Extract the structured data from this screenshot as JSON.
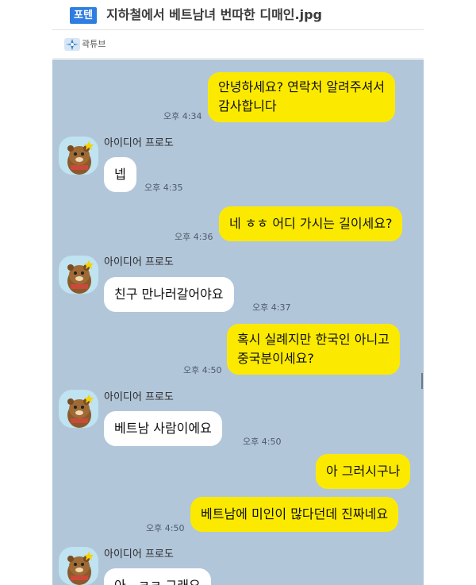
{
  "post": {
    "badge": "포텐",
    "title": "지하철에서 베트남녀 번따한 디매인.jpg",
    "author": "곽튜브"
  },
  "chat": {
    "messages": [
      {
        "sender": "me",
        "lines": [
          "안녕하세요? 연락처 알려주셔서",
          "감사합니다"
        ],
        "time": "오후 4:34"
      },
      {
        "sender": "them",
        "name": "아이디어 프로도",
        "lines": [
          "넵"
        ],
        "time": "오후 4:35"
      },
      {
        "sender": "me",
        "lines": [
          "네 ㅎㅎ 어디 가시는 길이세요?"
        ],
        "time": "오후 4:36"
      },
      {
        "sender": "them",
        "name": "아이디어 프로도",
        "lines": [
          "친구 만나러갈어야요"
        ],
        "time": "오후 4:37"
      },
      {
        "sender": "me",
        "lines": [
          "혹시 실례지만 한국인 아니고",
          "중국분이세요?"
        ],
        "time": "오후 4:50"
      },
      {
        "sender": "them",
        "name": "아이디어 프로도",
        "lines": [
          "베트남 사람이에요"
        ],
        "time": "오후 4:50"
      },
      {
        "sender": "me",
        "lines": [
          "아 그러시구나"
        ],
        "time": ""
      },
      {
        "sender": "me",
        "lines": [
          "베트남에 미인이 많다던데 진짜네요"
        ],
        "time": "오후 4:50"
      },
      {
        "sender": "them",
        "name": "아이디어 프로도",
        "lines": [
          "아.. ㅋㅋ 그래요"
        ],
        "time": ""
      }
    ]
  },
  "colors": {
    "chat_background": "#b2c6da",
    "my_bubble": "#fbea00",
    "their_bubble": "#ffffff",
    "badge": "#2f7de1"
  },
  "icons": {
    "author_logo": "blue-sparkle-logo",
    "avatar": "frodo-character-avatar"
  }
}
